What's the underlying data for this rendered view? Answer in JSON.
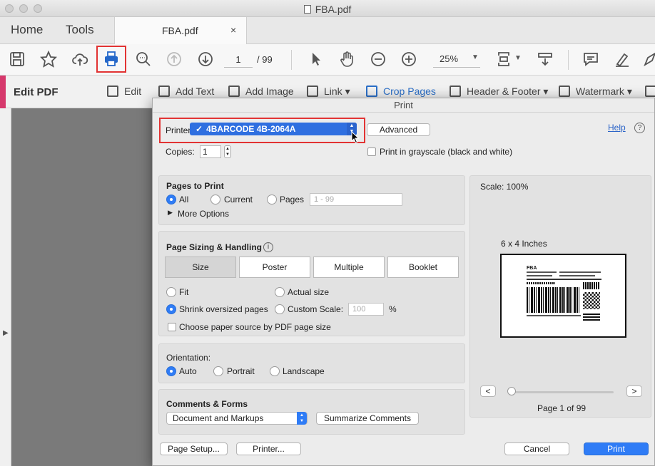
{
  "window": {
    "title": "FBA.pdf"
  },
  "tabs": {
    "home": "Home",
    "tools": "Tools",
    "document": "FBA.pdf",
    "close": "×"
  },
  "toolbar": {
    "current_page": "1",
    "page_total": "/ 99",
    "zoom": "25%"
  },
  "edit_bar": {
    "title": "Edit PDF",
    "tools": [
      "Edit",
      "Add Text",
      "Add Image",
      "Link ▾",
      "Crop Pages",
      "Header & Footer ▾",
      "Watermark ▾"
    ]
  },
  "print_dialog": {
    "title": "Print",
    "printer_label": "Printer:",
    "printer_value": "4BARCODE 4B-2064A",
    "advanced_button": "Advanced",
    "help_link": "Help",
    "help_icon": "?",
    "copies_label": "Copies:",
    "copies_value": "1",
    "grayscale_label": "Print in grayscale (black and white)",
    "grayscale_checked": false,
    "pages_to_print": {
      "title": "Pages to Print",
      "options": [
        "All",
        "Current",
        "Pages"
      ],
      "selected": "All",
      "range_placeholder": "1 - 99",
      "more_options": "More Options"
    },
    "page_sizing": {
      "title": "Page Sizing & Handling",
      "info_icon": "i",
      "modes": [
        "Size",
        "Poster",
        "Multiple",
        "Booklet"
      ],
      "selected_mode": "Size",
      "fit": "Fit",
      "actual_size": "Actual size",
      "shrink": "Shrink oversized pages",
      "custom_scale": "Custom Scale:",
      "custom_scale_value": "100",
      "percent": "%",
      "selected_option": "Shrink oversized pages",
      "paper_source": "Choose paper source by PDF page size",
      "paper_source_checked": false
    },
    "orientation": {
      "title": "Orientation:",
      "options": [
        "Auto",
        "Portrait",
        "Landscape"
      ],
      "selected": "Auto"
    },
    "comments_forms": {
      "title": "Comments & Forms",
      "select_value": "Document and Markups",
      "summarize_button": "Summarize Comments"
    },
    "preview": {
      "scale": "Scale: 100%",
      "paper_size": "6 x 4 Inches",
      "label_text": "FBA",
      "prev": "<",
      "next": ">",
      "page_indicator": "Page 1 of 99"
    },
    "footer": {
      "page_setup": "Page Setup...",
      "printer": "Printer...",
      "cancel": "Cancel",
      "print": "Print"
    }
  },
  "colors": {
    "accent_blue": "#2f7cf6",
    "highlight_red": "#e23333",
    "edit_accent": "#d6386c"
  }
}
